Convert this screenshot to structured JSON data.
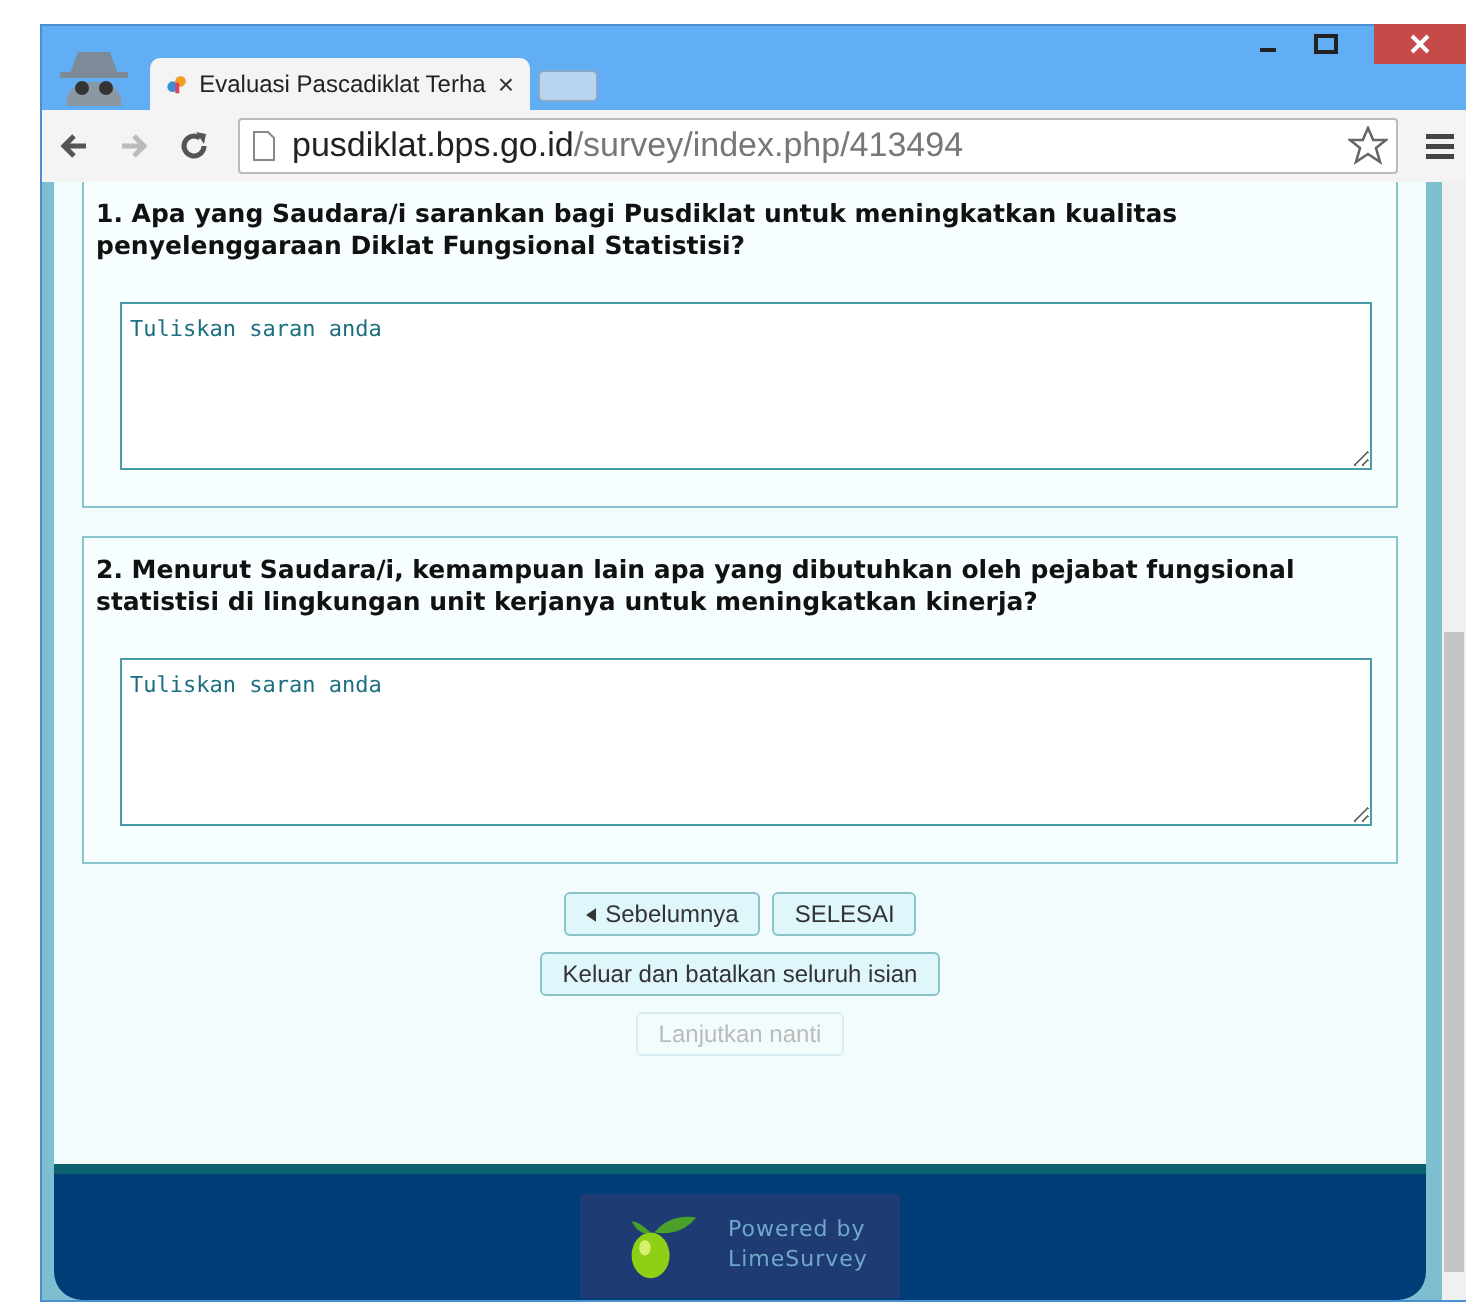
{
  "browser": {
    "tab_title": "Evaluasi Pascadiklat Terha",
    "tab_close": "×",
    "url_host": "pusdiklat.bps.go.id",
    "url_path": "/survey/index.php/413494"
  },
  "questions": [
    {
      "number": "1.",
      "text": "Apa yang Saudara/i sarankan bagi Pusdiklat untuk meningkatkan kualitas penyelenggaraan Diklat Fungsional Statistisi?",
      "value": "Tuliskan saran anda"
    },
    {
      "number": "2.",
      "text": "Menurut Saudara/i, kemampuan lain apa yang dibutuhkan oleh pejabat fungsional statistisi di lingkungan unit kerjanya untuk meningkatkan kinerja?",
      "value": "Tuliskan saran anda"
    }
  ],
  "button_rows": [
    [
      {
        "label": "Sebelumnya",
        "kind": "prev",
        "disabled": false
      },
      {
        "label": "SELESAI",
        "kind": "plain",
        "disabled": false
      }
    ],
    [
      {
        "label": "Keluar dan batalkan seluruh isian",
        "kind": "plain",
        "disabled": false
      }
    ],
    [
      {
        "label": "Lanjutkan nanti",
        "kind": "plain",
        "disabled": true
      }
    ]
  ],
  "footer": {
    "powered": "Powered by",
    "brand": "LimeSurvey"
  }
}
